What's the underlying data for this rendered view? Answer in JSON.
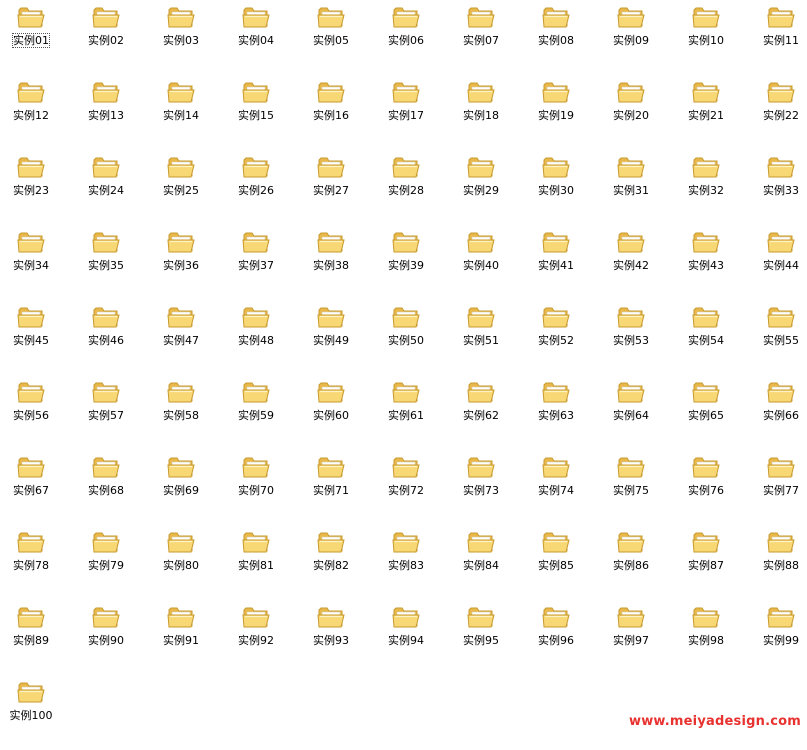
{
  "folders": [
    "实例01",
    "实例02",
    "实例03",
    "实例04",
    "实例05",
    "实例06",
    "实例07",
    "实例08",
    "实例09",
    "实例10",
    "实例11",
    "实例12",
    "实例13",
    "实例14",
    "实例15",
    "实例16",
    "实例17",
    "实例18",
    "实例19",
    "实例20",
    "实例21",
    "实例22",
    "实例23",
    "实例24",
    "实例25",
    "实例26",
    "实例27",
    "实例28",
    "实例29",
    "实例30",
    "实例31",
    "实例32",
    "实例33",
    "实例34",
    "实例35",
    "实例36",
    "实例37",
    "实例38",
    "实例39",
    "实例40",
    "实例41",
    "实例42",
    "实例43",
    "实例44",
    "实例45",
    "实例46",
    "实例47",
    "实例48",
    "实例49",
    "实例50",
    "实例51",
    "实例52",
    "实例53",
    "实例54",
    "实例55",
    "实例56",
    "实例57",
    "实例58",
    "实例59",
    "实例60",
    "实例61",
    "实例62",
    "实例63",
    "实例64",
    "实例65",
    "实例66",
    "实例67",
    "实例68",
    "实例69",
    "实例70",
    "实例71",
    "实例72",
    "实例73",
    "实例74",
    "实例75",
    "实例76",
    "实例77",
    "实例78",
    "实例79",
    "实例80",
    "实例81",
    "实例82",
    "实例83",
    "实例84",
    "实例85",
    "实例86",
    "实例87",
    "实例88",
    "实例89",
    "实例90",
    "实例91",
    "实例92",
    "实例93",
    "实例94",
    "实例95",
    "实例96",
    "实例97",
    "实例98",
    "实例99",
    "实例100"
  ],
  "selected_folder": "实例01",
  "folder_icon": "folder-icon",
  "colors": {
    "folder_body": "#f8d775",
    "folder_back": "#e9b84a",
    "folder_outline": "#c89a2e",
    "folder_highlight": "#fff3c4",
    "watermark": "#e8322f"
  },
  "watermark": "www.meiyadesign.com"
}
